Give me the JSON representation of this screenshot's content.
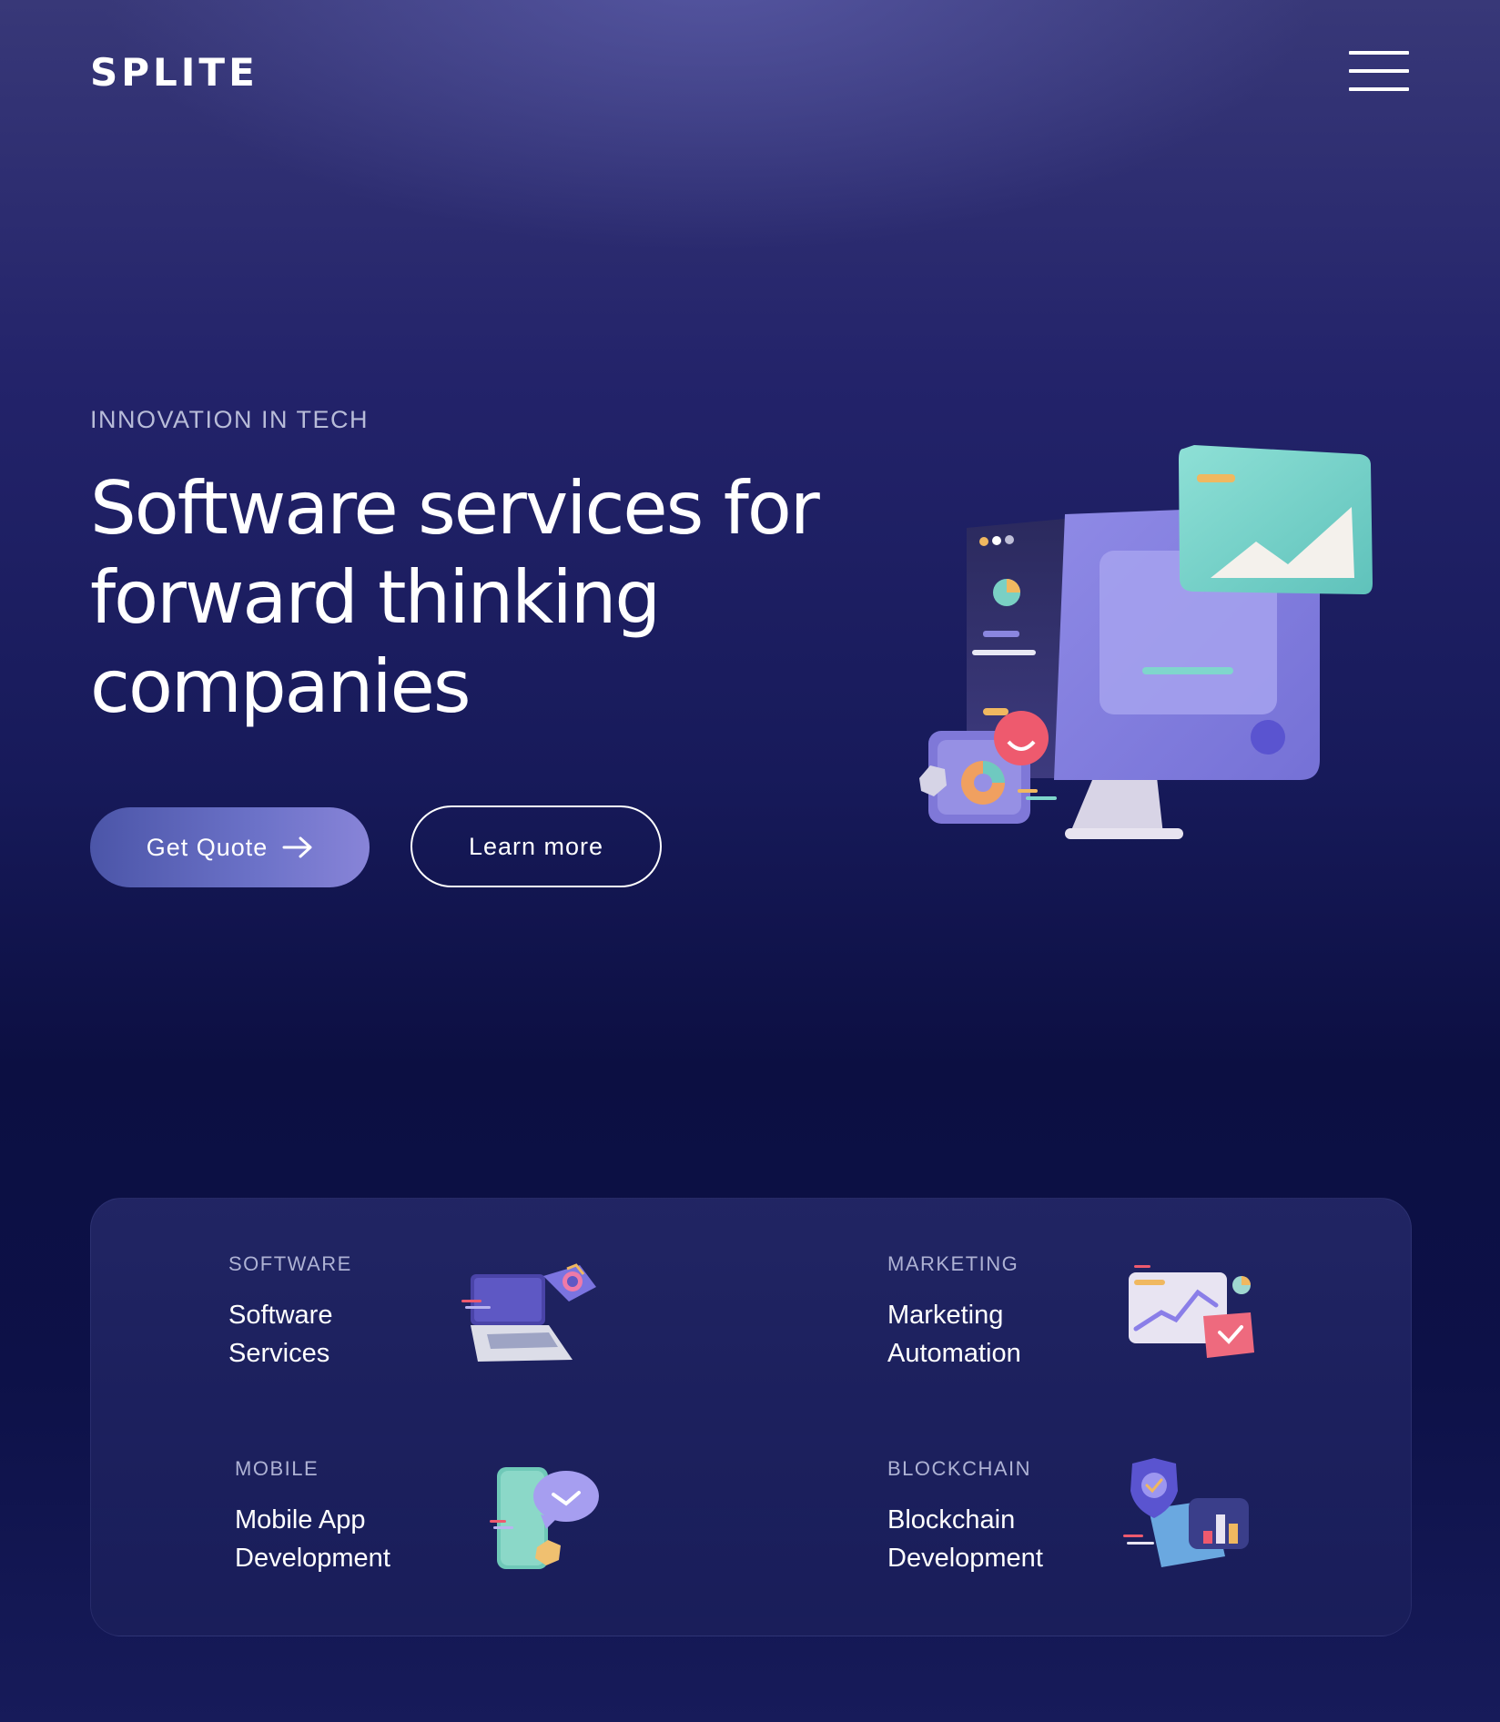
{
  "brand": {
    "logo_text": "SPLITE"
  },
  "header": {
    "menu_icon": "hamburger-menu-icon"
  },
  "hero": {
    "eyebrow": "INNOVATION IN TECH",
    "title": "Software services for forward thinking companies",
    "primary_button": {
      "label": "Get Quote",
      "icon": "arrow-right-icon"
    },
    "secondary_button": {
      "label": "Learn more"
    },
    "illustration": "computer-monitor-illustration"
  },
  "services": [
    {
      "category": "SOFTWARE",
      "title_line1": "Software",
      "title_line2": "Services",
      "icon": "laptop-icon"
    },
    {
      "category": "MARKETING",
      "title_line1": "Marketing",
      "title_line2": "Automation",
      "icon": "chart-window-icon"
    },
    {
      "category": "MOBILE",
      "title_line1": "Mobile App",
      "title_line2": "Development",
      "icon": "phone-icon"
    },
    {
      "category": "BLOCKCHAIN",
      "title_line1": "Blockchain",
      "title_line2": "Development",
      "icon": "shield-blocks-icon"
    }
  ],
  "colors": {
    "background_top": "#383878",
    "background_mid": "#0c0f42",
    "accent_button": "#6c72c8",
    "illustration_purple": "#8a86e0",
    "illustration_teal": "#7fd6cc"
  }
}
